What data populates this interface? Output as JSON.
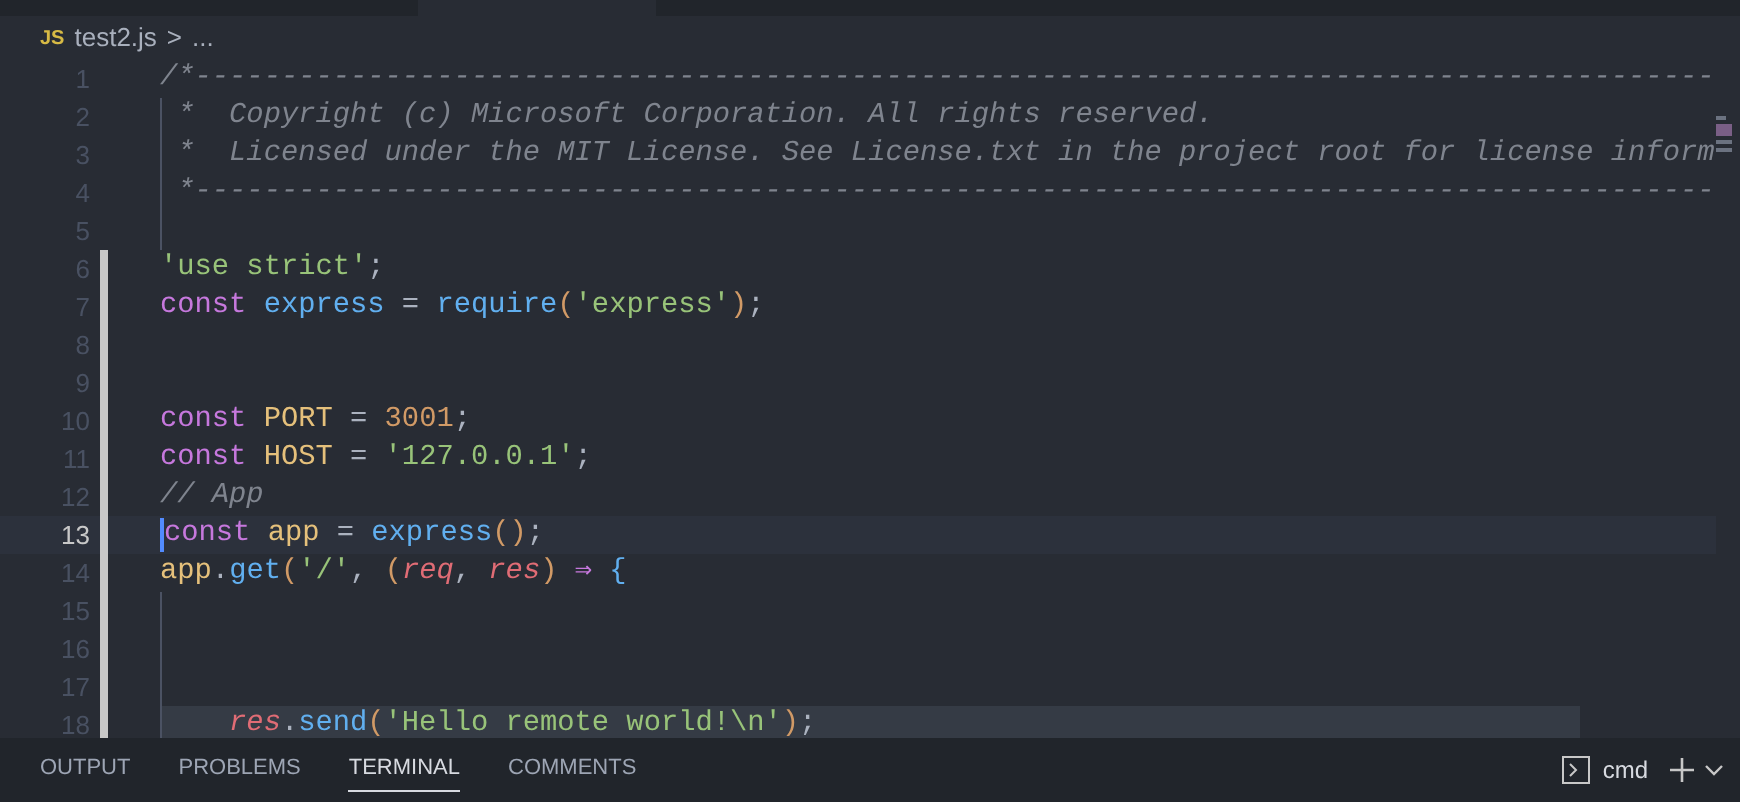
{
  "breadcrumb": {
    "badge": "JS",
    "file": "test2.js",
    "separator": ">",
    "more": "..."
  },
  "lines": [
    {
      "number": "1",
      "current": false,
      "modified": false,
      "highlighted": false,
      "guide": false,
      "tokens": [
        {
          "kind": "comment",
          "text": "/*----------------------------------------------------------------------------------------"
        }
      ]
    },
    {
      "number": "2",
      "current": false,
      "modified": false,
      "highlighted": false,
      "guide": true,
      "tokens": [
        {
          "kind": "comment",
          "text": " *  Copyright (c) Microsoft Corporation. All rights reserved."
        }
      ]
    },
    {
      "number": "3",
      "current": false,
      "modified": false,
      "highlighted": false,
      "guide": true,
      "tokens": [
        {
          "kind": "comment",
          "text": " *  Licensed under the MIT License. See License.txt in the project root for license inform"
        }
      ]
    },
    {
      "number": "4",
      "current": false,
      "modified": false,
      "highlighted": false,
      "guide": true,
      "tokens": [
        {
          "kind": "comment",
          "text": " *----------------------------------------------------------------------------------------"
        }
      ]
    },
    {
      "number": "5",
      "current": false,
      "modified": false,
      "highlighted": false,
      "guide": true
    },
    {
      "number": "6",
      "current": false,
      "modified": true,
      "highlighted": false,
      "guide": false,
      "tokens": [
        {
          "kind": "string",
          "text": "'use strict'"
        },
        {
          "kind": "punct",
          "text": ";"
        }
      ]
    },
    {
      "number": "7",
      "current": false,
      "modified": true,
      "highlighted": false,
      "guide": false,
      "tokens": [
        {
          "kind": "keyword",
          "text": "const"
        },
        {
          "kind": "function",
          "text": " express"
        },
        {
          "kind": "punct",
          "text": " = "
        },
        {
          "kind": "function",
          "text": "require"
        },
        {
          "kind": "paren",
          "text": "("
        },
        {
          "kind": "string",
          "text": "'express'"
        },
        {
          "kind": "paren",
          "text": ")"
        },
        {
          "kind": "punct",
          "text": ";"
        }
      ]
    },
    {
      "number": "8",
      "current": false,
      "modified": true,
      "highlighted": false,
      "guide": false
    },
    {
      "number": "9",
      "current": false,
      "modified": true,
      "highlighted": false,
      "guide": false
    },
    {
      "number": "10",
      "current": false,
      "modified": true,
      "highlighted": false,
      "guide": false,
      "tokens": [
        {
          "kind": "keyword",
          "text": "const"
        },
        {
          "kind": "constant",
          "text": " PORT"
        },
        {
          "kind": "punct",
          "text": " = "
        },
        {
          "kind": "number",
          "text": "3001"
        },
        {
          "kind": "punct",
          "text": ";"
        }
      ]
    },
    {
      "number": "11",
      "current": false,
      "modified": true,
      "highlighted": false,
      "guide": false,
      "tokens": [
        {
          "kind": "keyword",
          "text": "const"
        },
        {
          "kind": "constant",
          "text": " HOST"
        },
        {
          "kind": "punct",
          "text": " = "
        },
        {
          "kind": "string",
          "text": "'127.0.0.1'"
        },
        {
          "kind": "punct",
          "text": ";"
        }
      ]
    },
    {
      "number": "12",
      "current": false,
      "modified": true,
      "highlighted": false,
      "guide": false,
      "tokens": [
        {
          "kind": "comment",
          "text": "// App"
        }
      ]
    },
    {
      "number": "13",
      "current": true,
      "modified": true,
      "highlighted": false,
      "guide": false,
      "tokens": [
        {
          "kind": "keyword",
          "text": "const"
        },
        {
          "kind": "constant",
          "text": " app"
        },
        {
          "kind": "punct",
          "text": " = "
        },
        {
          "kind": "function",
          "text": "express"
        },
        {
          "kind": "paren",
          "text": "()"
        },
        {
          "kind": "punct",
          "text": ";"
        }
      ]
    },
    {
      "number": "14",
      "current": false,
      "modified": true,
      "highlighted": false,
      "guide": false,
      "tokens": [
        {
          "kind": "constant",
          "text": "app"
        },
        {
          "kind": "punct",
          "text": "."
        },
        {
          "kind": "function",
          "text": "get"
        },
        {
          "kind": "paren",
          "text": "("
        },
        {
          "kind": "string",
          "text": "'/'"
        },
        {
          "kind": "punct",
          "text": ", "
        },
        {
          "kind": "paren",
          "text": "("
        },
        {
          "kind": "param",
          "text": "req"
        },
        {
          "kind": "punct",
          "text": ", "
        },
        {
          "kind": "param",
          "text": "res"
        },
        {
          "kind": "paren",
          "text": ")"
        },
        {
          "kind": "keyword",
          "text": " ⇒"
        },
        {
          "kind": "function",
          "text": " {"
        }
      ]
    },
    {
      "number": "15",
      "current": false,
      "modified": true,
      "highlighted": false,
      "guide": true
    },
    {
      "number": "16",
      "current": false,
      "modified": true,
      "highlighted": false,
      "guide": true
    },
    {
      "number": "17",
      "current": false,
      "modified": true,
      "highlighted": false,
      "guide": true
    },
    {
      "number": "18",
      "current": false,
      "modified": true,
      "highlighted": true,
      "guide": true,
      "tokens": [
        {
          "kind": "param",
          "text": "    res"
        },
        {
          "kind": "punct",
          "text": "."
        },
        {
          "kind": "function",
          "text": "send"
        },
        {
          "kind": "paren",
          "text": "("
        },
        {
          "kind": "string",
          "text": "'Hello remote world!\\n'"
        },
        {
          "kind": "paren",
          "text": ")"
        },
        {
          "kind": "punct",
          "text": ";"
        }
      ]
    }
  ],
  "panel": {
    "tabs": [
      {
        "label": "OUTPUT",
        "selected": false
      },
      {
        "label": "PROBLEMS",
        "selected": false
      },
      {
        "label": "TERMINAL",
        "selected": true
      },
      {
        "label": "COMMENTS",
        "selected": false
      }
    ],
    "terminal": "cmd"
  }
}
